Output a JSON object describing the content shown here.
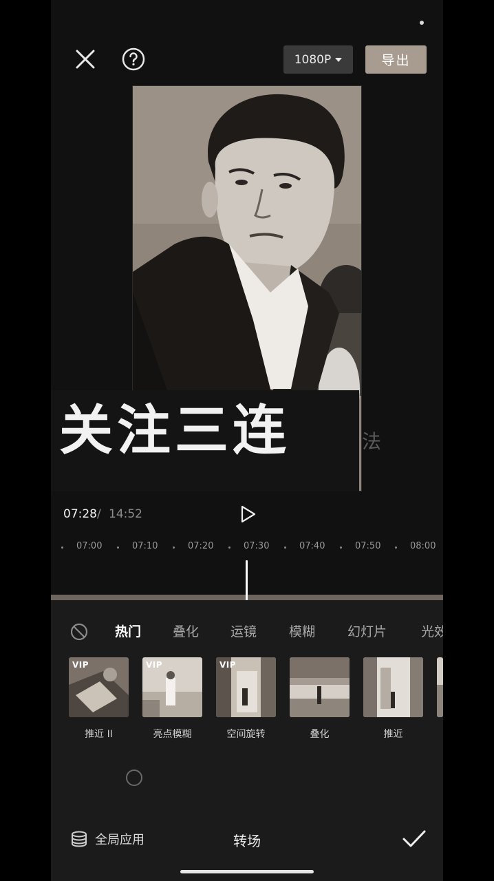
{
  "toolbar": {
    "close_icon": "close-icon",
    "help_icon": "help-icon",
    "resolution_label": "1080P",
    "export_label": "导出"
  },
  "preview": {
    "caption": "关注三连",
    "ghost_char": "法"
  },
  "playback": {
    "current_time": "07:28",
    "separator": "/",
    "total_time": "14:52",
    "play_icon": "play-icon"
  },
  "timeline": {
    "ticks": [
      "07:00",
      "07:10",
      "07:20",
      "07:30",
      "07:40",
      "07:50",
      "08:00"
    ]
  },
  "transitions": {
    "tabs": [
      {
        "label": "热门",
        "active": true
      },
      {
        "label": "叠化",
        "active": false
      },
      {
        "label": "运镜",
        "active": false
      },
      {
        "label": "模糊",
        "active": false
      },
      {
        "label": "幻灯片",
        "active": false
      },
      {
        "label": "光效",
        "active": false
      }
    ],
    "items": [
      {
        "label": "推近 II",
        "vip": "VIP"
      },
      {
        "label": "亮点模糊",
        "vip": "VIP"
      },
      {
        "label": "空间旋转",
        "vip": "VIP"
      },
      {
        "label": "叠化",
        "vip": ""
      },
      {
        "label": "推近",
        "vip": ""
      }
    ]
  },
  "footer": {
    "apply_all_label": "全局应用",
    "title": "转场",
    "confirm_icon": "check-icon"
  },
  "colors": {
    "export_button": "#a89c90",
    "panel_bg": "#1b1b1b",
    "screen_bg": "#111111"
  }
}
